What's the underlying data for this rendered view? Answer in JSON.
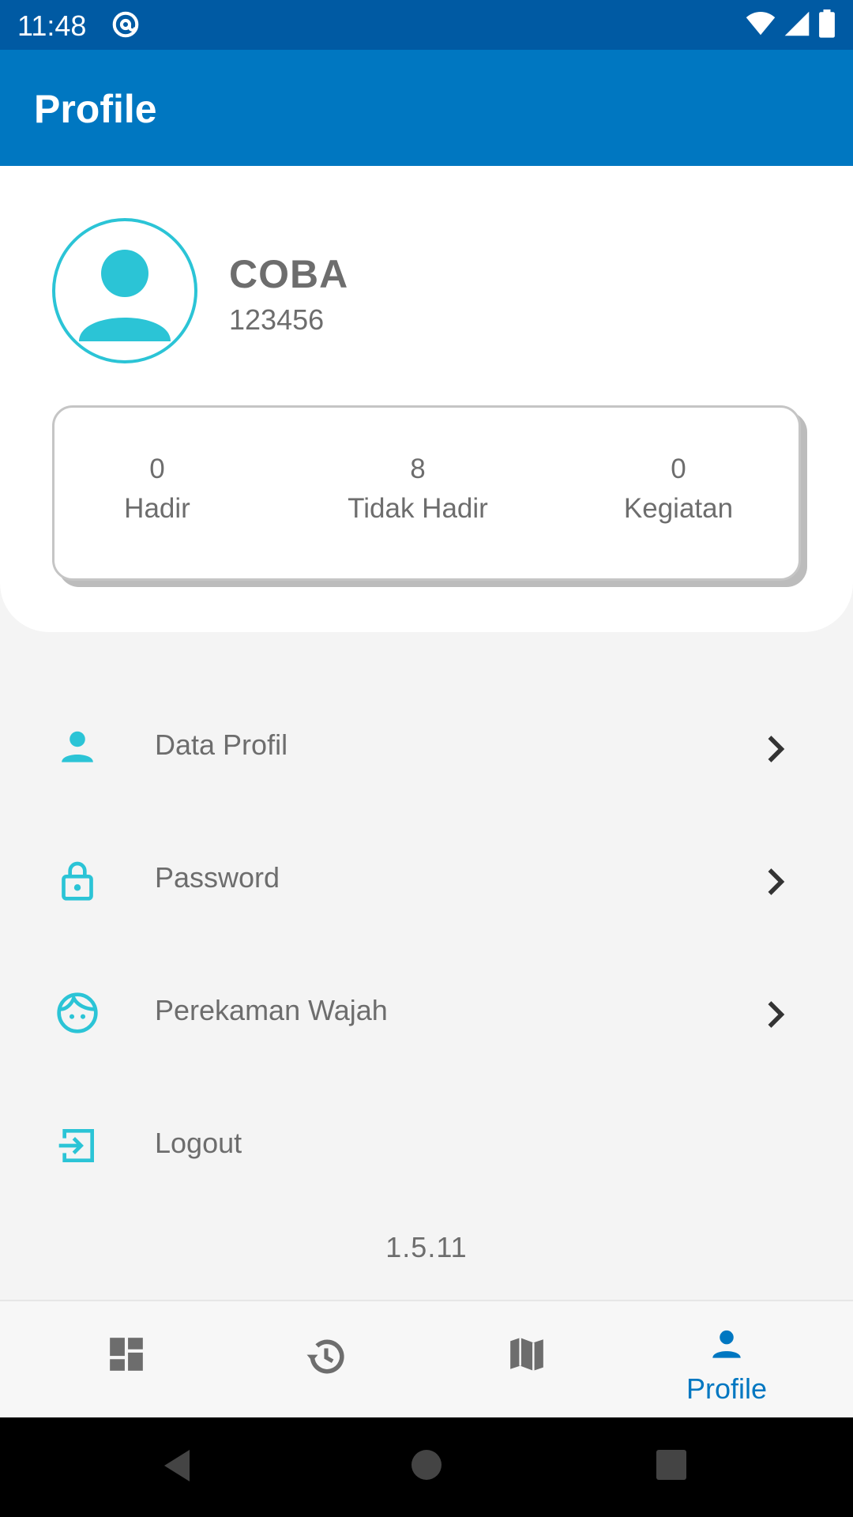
{
  "status_bar": {
    "time": "11:48",
    "icons": [
      "at-sign-icon",
      "wifi-icon",
      "signal-icon",
      "battery-icon"
    ]
  },
  "app_bar": {
    "title": "Profile"
  },
  "profile": {
    "name": "COBA",
    "id": "123456",
    "avatar_icon": "person-icon"
  },
  "stats": [
    {
      "value": "0",
      "label": "Hadir"
    },
    {
      "value": "8",
      "label": "Tidak Hadir"
    },
    {
      "value": "0",
      "label": "Kegiatan"
    }
  ],
  "menu": [
    {
      "label": "Data Profil",
      "icon": "person-icon"
    },
    {
      "label": "Password",
      "icon": "lock-icon"
    },
    {
      "label": "Perekaman Wajah",
      "icon": "face-icon"
    },
    {
      "label": "Logout",
      "icon": "logout-icon"
    }
  ],
  "version": "1.5.11",
  "bottom_nav": {
    "items": [
      {
        "icon": "dashboard-icon",
        "label": ""
      },
      {
        "icon": "history-icon",
        "label": ""
      },
      {
        "icon": "map-icon",
        "label": ""
      },
      {
        "icon": "person-icon",
        "label": "Profile",
        "active": true
      }
    ]
  },
  "colors": {
    "status_bar": "#005aa3",
    "app_bar": "#0077c1",
    "accent_teal": "#2bc4d6",
    "text_gray": "#6d6d6d",
    "nav_active": "#0077c1",
    "nav_inactive": "#6d6d6d"
  }
}
